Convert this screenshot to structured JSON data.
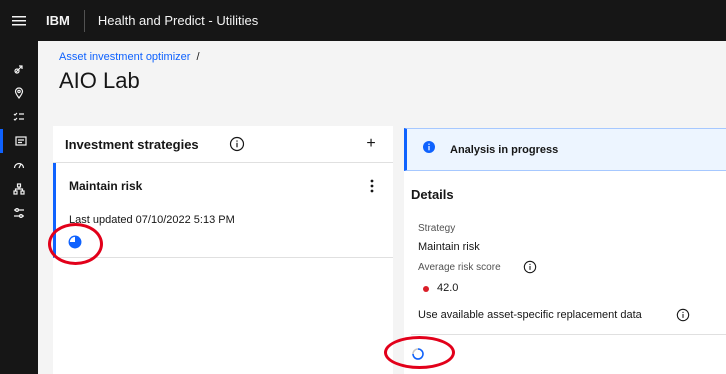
{
  "header": {
    "brand": "IBM",
    "app_name": "Health and Predict - Utilities"
  },
  "sidebar": {
    "items": [
      {
        "icon": "rocket-icon"
      },
      {
        "icon": "location-icon"
      },
      {
        "icon": "task-list-icon"
      },
      {
        "icon": "dashboard-icon",
        "active": true
      },
      {
        "icon": "meter-icon"
      },
      {
        "icon": "hierarchy-icon"
      },
      {
        "icon": "settings-adjust-icon"
      }
    ]
  },
  "breadcrumb": {
    "parent": "Asset investment optimizer",
    "separator": "/"
  },
  "page": {
    "title": "AIO Lab"
  },
  "strategies": {
    "title": "Investment strategies",
    "add_label": "+",
    "items": [
      {
        "name": "Maintain risk",
        "updated": "Last updated 07/10/2022 5:13 PM",
        "status_icon": "in-progress-pie-icon"
      }
    ]
  },
  "notification": {
    "text": "Analysis in progress",
    "icon": "info-icon"
  },
  "details": {
    "title": "Details",
    "strategy_label": "Strategy",
    "strategy_value": "Maintain risk",
    "risk_label": "Average risk score",
    "risk_value": "42.0",
    "replacement_label": "Use available asset-specific replacement data"
  },
  "colors": {
    "accent": "#0f62fe",
    "risk": "#da1e28",
    "annotation": "#e2001a",
    "shell": "#161616"
  }
}
